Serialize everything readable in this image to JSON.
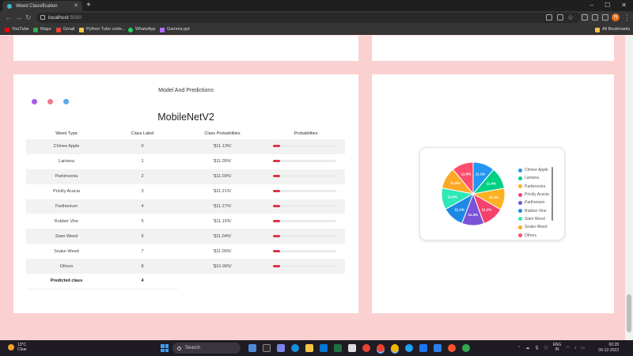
{
  "browser": {
    "tab_title": "Weed Classification",
    "url_host": "localhost",
    "url_port": ":5000",
    "profile_initial": "N",
    "bookmarks": [
      "YouTube",
      "Maps",
      "Gmail",
      "Python Tutor code...",
      "WhatsApp",
      "Gamma ppt"
    ],
    "all_bookmarks": "All Bookmarks"
  },
  "section": {
    "title": "Model And Predictions",
    "model_name": "MobileNetV2"
  },
  "table": {
    "headers": [
      "Weed Type",
      "Class Label",
      "Class Probabilities",
      "Probabilities"
    ],
    "rows": [
      {
        "type": "Chinee Apple",
        "label": "0",
        "prob_text": "'$11.13%'",
        "prob": 11.13
      },
      {
        "type": "Lantana",
        "label": "1",
        "prob_text": "'$11.05%'",
        "prob": 11.05
      },
      {
        "type": "Parkinsonia",
        "label": "2",
        "prob_text": "'$11.09%'",
        "prob": 11.09
      },
      {
        "type": "Prickly Acacia",
        "label": "3",
        "prob_text": "'$11.21%'",
        "prob": 11.21
      },
      {
        "type": "Parthenium",
        "label": "4",
        "prob_text": "'$11.27%'",
        "prob": 11.27
      },
      {
        "type": "Rubber Vine",
        "label": "5",
        "prob_text": "'$11.15%'",
        "prob": 11.15
      },
      {
        "type": "Siam Weed",
        "label": "6",
        "prob_text": "'$11.04%'",
        "prob": 11.04
      },
      {
        "type": "Snake Weed",
        "label": "7",
        "prob_text": "'$11.06%'",
        "prob": 11.06
      },
      {
        "type": "Others",
        "label": "8",
        "prob_text": "'$10.99%'",
        "prob": 10.99
      }
    ],
    "predicted_label": "Predicted class",
    "predicted_value": "4"
  },
  "chart_data": {
    "type": "pie",
    "categories": [
      "Chinee Apple",
      "Lantana",
      "Parkinsonia",
      "Prickly Acacia",
      "Parthenium",
      "Rubber Vine",
      "Siam Weed",
      "Snake Weed",
      "Others"
    ],
    "values": [
      11.1,
      11.0,
      11.1,
      11.2,
      11.3,
      11.1,
      11.0,
      11.0,
      11.0
    ],
    "slice_labels": [
      "11.1%",
      "11.0%",
      "11.1%",
      "11.2%",
      "11.3%",
      "11.1%",
      "11.0%",
      "11.0%",
      "11.0%"
    ],
    "colors": [
      "#2196f3",
      "#00d084",
      "#fdb022",
      "#f5426c",
      "#7b52d6",
      "#1e88e5",
      "#2ee8b6",
      "#ffa726",
      "#ff4d6d"
    ],
    "legend_placement": "right"
  },
  "taskbar": {
    "temperature": "13°C",
    "condition": "Clear",
    "search_placeholder": "Search",
    "lang_1": "ENG",
    "lang_2": "IN",
    "time": "00:28",
    "date": "06-12-2023"
  }
}
